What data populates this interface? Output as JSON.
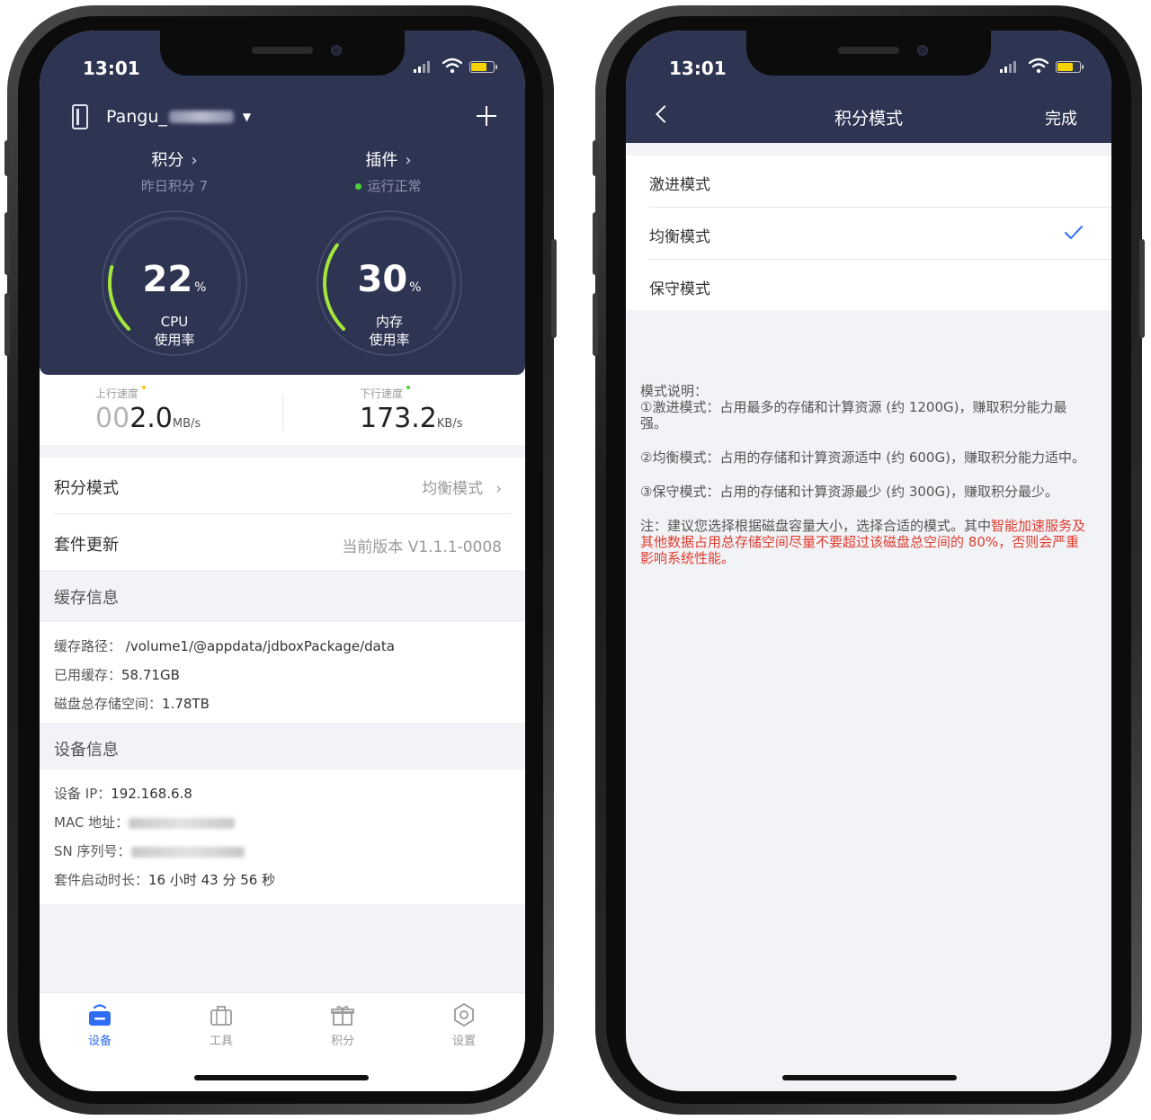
{
  "status_bar": {
    "time": "13:01"
  },
  "left": {
    "device": {
      "name": "Pangu_"
    },
    "points": {
      "title": "积分",
      "sub": "昨日积分 7"
    },
    "plugins": {
      "title": "插件",
      "sub": "运行正常"
    },
    "cpu": {
      "value": "22",
      "unit": "%",
      "label1": "CPU",
      "label2": "使用率",
      "fraction": 0.22
    },
    "mem": {
      "value": "30",
      "unit": "%",
      "label1": "内存",
      "label2": "使用率",
      "fraction": 0.3
    },
    "upload": {
      "label": "上行速度",
      "dim": "00",
      "value": "2.0",
      "unit": "MB/s"
    },
    "download": {
      "label": "下行速度",
      "value": "173.2",
      "unit": "KB/s"
    },
    "points_mode": {
      "label": "积分模式",
      "value": "均衡模式"
    },
    "kit_update": {
      "label": "套件更新",
      "value": "当前版本 V1.1.1-0008"
    },
    "cache": {
      "title": "缓存信息",
      "path_label": "缓存路径：",
      "path_value": "/volume1/@appdata/jdboxPackage/data",
      "used_label": "已用缓存：",
      "used_value": "58.71GB",
      "total_label": "磁盘总存储空间：",
      "total_value": "1.78TB"
    },
    "device_info": {
      "title": "设备信息",
      "ip_label": "设备 IP：",
      "ip_value": "192.168.6.8",
      "mac_label": "MAC 地址：",
      "sn_label": "SN 序列号：",
      "uptime_label": "套件启动时长：",
      "uptime_value": "16 小时 43 分 56 秒"
    },
    "tabs": [
      {
        "label": "设备"
      },
      {
        "label": "工具"
      },
      {
        "label": "积分"
      },
      {
        "label": "设置"
      }
    ]
  },
  "right": {
    "nav": {
      "title": "积分模式",
      "done": "完成"
    },
    "modes": [
      {
        "label": "激进模式"
      },
      {
        "label": "均衡模式"
      },
      {
        "label": "保守模式"
      }
    ],
    "selected_mode": "均衡模式",
    "desc": {
      "heading": "模式说明：",
      "aggressive": "①激进模式：占用最多的存储和计算资源 (约 1200G)，赚取积分能力最强。",
      "balanced": "②均衡模式：占用的存储和计算资源适中 (约 600G)，赚取积分能力适中。",
      "conservative": "③保守模式：占用的存储和计算资源最少 (约 300G)，赚取积分最少。",
      "note_prefix": "注：建议您选择根据磁盘容量大小，选择合适的模式。其中",
      "note_red": "智能加速服务及其他数据占用总存储空间尽量不要超过该磁盘总空间的 80%，否则会严重影响系统性能。"
    }
  },
  "colors": {
    "header_bg": "#2e3553",
    "accent": "#2d6df6",
    "gauge_green": "#a4e639",
    "warning_red": "#e03c2e"
  }
}
